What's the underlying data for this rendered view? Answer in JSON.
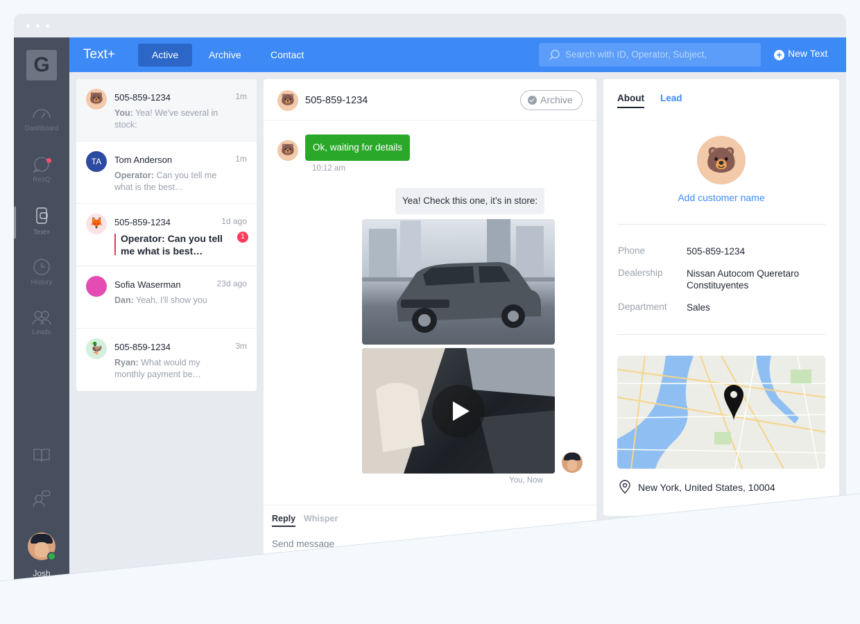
{
  "app": {
    "logo_letter": "G",
    "brand": "Text+"
  },
  "rail": {
    "items": [
      {
        "label": "Dashboard",
        "icon": "gauge-icon"
      },
      {
        "label": "ResQ",
        "icon": "chat-bubble-icon",
        "badge": "1"
      },
      {
        "label": "Text+",
        "icon": "phone-chat-icon",
        "active": true
      },
      {
        "label": "History",
        "icon": "clock-icon"
      },
      {
        "label": "Leads",
        "icon": "people-icon"
      }
    ],
    "bottom_icons": [
      "book-icon",
      "user-chat-icon"
    ],
    "user_name": "Josh"
  },
  "topbar": {
    "tabs": [
      {
        "label": "Active",
        "active": true
      },
      {
        "label": "Archive"
      },
      {
        "label": "Contact"
      }
    ],
    "search_placeholder": "Search with ID, Operator, Subject,",
    "new_text_label": "New Text"
  },
  "conversations": [
    {
      "name": "505-859-1234",
      "time": "1m",
      "sender": "You:",
      "preview": "Yea! We've several in stock:",
      "avatar": "bear",
      "selected": true
    },
    {
      "name": "Tom Anderson",
      "time": "1m",
      "sender": "Operator:",
      "preview": "Can you tell me what is the best…",
      "avatar": "TA"
    },
    {
      "name": "505-859-1234",
      "time": "1d ago",
      "preview": "Operator: Can you tell me what is best…",
      "avatar": "fox",
      "unread": "1"
    },
    {
      "name": "Sofia Waserman",
      "time": "23d ago",
      "sender": "Dan:",
      "preview": "Yeah, I'll show you",
      "avatar": "pink"
    },
    {
      "name": "505-859-1234",
      "time": "3m",
      "sender": "Ryan:",
      "preview": "What would my monthly payment be…",
      "avatar": "duck"
    }
  ],
  "chat": {
    "contact": "505-859-1234",
    "archive_label": "Archive",
    "incoming": {
      "text": "Ok, waiting for details",
      "time": "10:12 am"
    },
    "outgoing": {
      "text": "Yea! Check this one, it’s in store:",
      "meta": "You, Now"
    },
    "composer": {
      "tab_reply": "Reply",
      "tab_whisper": "Whisper",
      "placeholder": "Send message"
    }
  },
  "info": {
    "tab_about": "About",
    "tab_lead": "Lead",
    "add_name": "Add customer name",
    "fields": [
      {
        "key": "Phone",
        "value": "505-859-1234"
      },
      {
        "key": "Dealership",
        "value": "Nissan Autocom Queretaro Constituyentes"
      },
      {
        "key": "Department",
        "value": "Sales"
      }
    ],
    "location": "New York, United States, 10004"
  },
  "colors": {
    "accent": "#3d8af7",
    "active_tab": "#2c67c7",
    "rail": "#474f5e",
    "incoming_bubble": "#2aa82a",
    "unread_badge": "#ff3b5c"
  }
}
